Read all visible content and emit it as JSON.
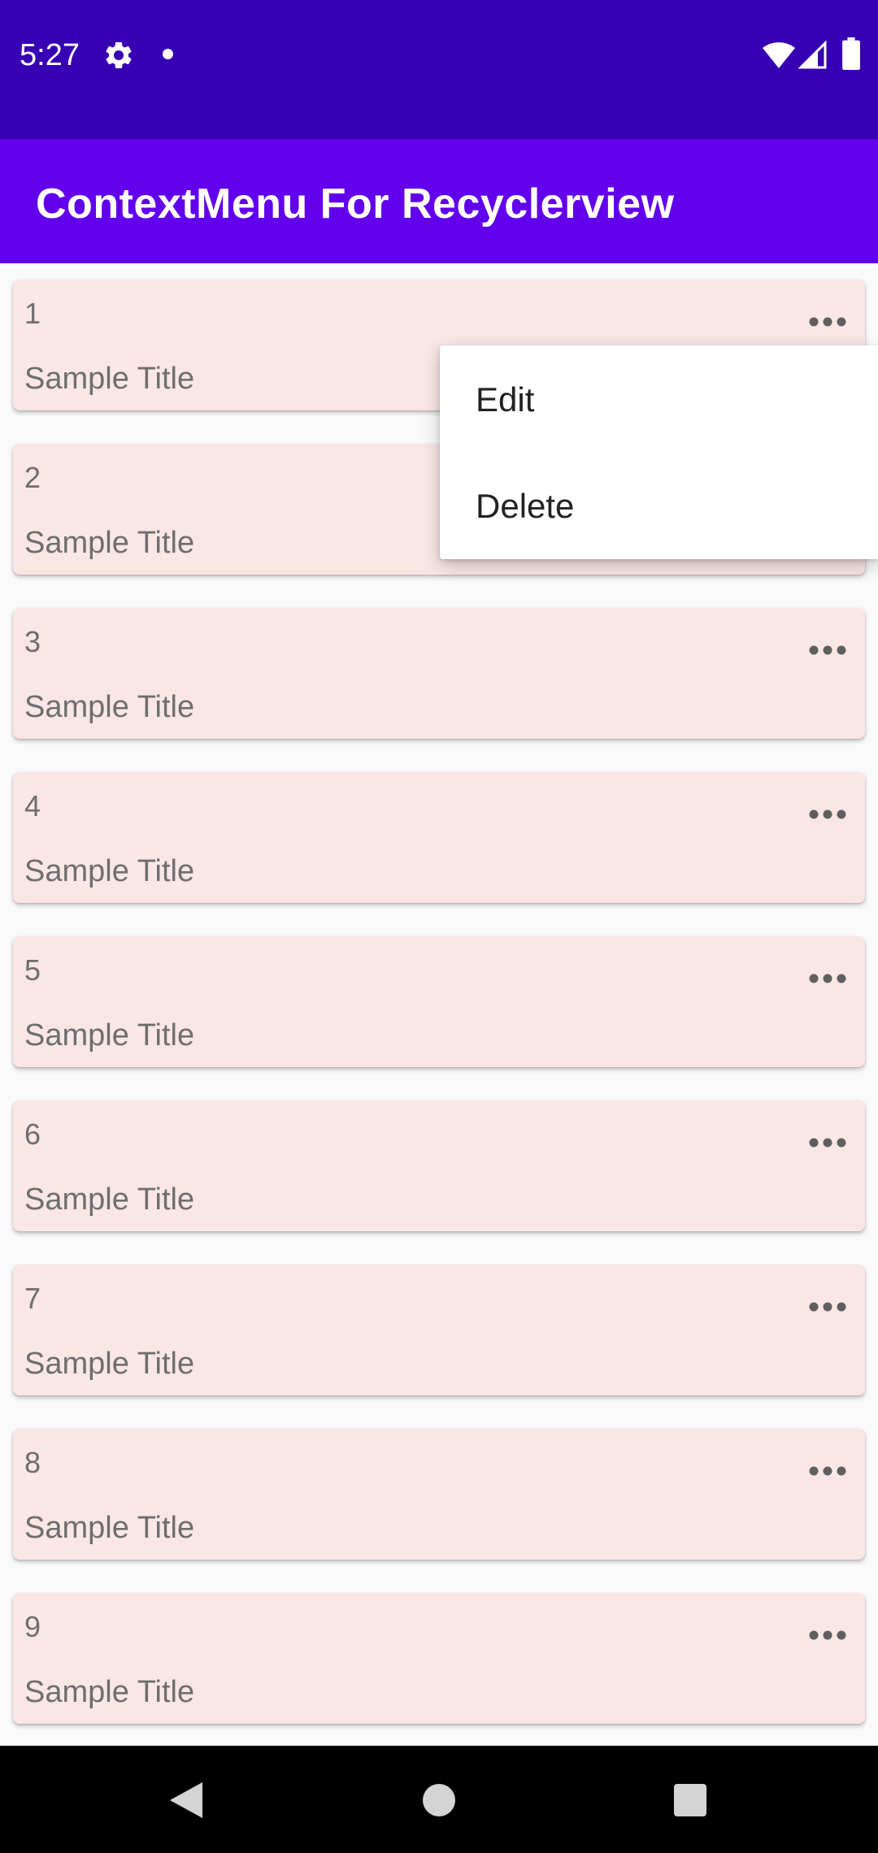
{
  "status_bar": {
    "time": "5:27",
    "icons": [
      "gear-icon",
      "dot-icon",
      "wifi-icon",
      "signal-icon",
      "battery-icon"
    ],
    "background": "#3700b3"
  },
  "app_bar": {
    "title": "ContextMenu For Recyclerview",
    "background": "#6200ee"
  },
  "list": {
    "items": [
      {
        "number": "1",
        "title": "Sample Title"
      },
      {
        "number": "2",
        "title": "Sample Title"
      },
      {
        "number": "3",
        "title": "Sample Title"
      },
      {
        "number": "4",
        "title": "Sample Title"
      },
      {
        "number": "5",
        "title": "Sample Title"
      },
      {
        "number": "6",
        "title": "Sample Title"
      },
      {
        "number": "7",
        "title": "Sample Title"
      },
      {
        "number": "8",
        "title": "Sample Title"
      },
      {
        "number": "9",
        "title": "Sample Title"
      }
    ],
    "card_color": "#fae7e5",
    "more_icon": "more-horiz-icon"
  },
  "context_menu": {
    "items": [
      {
        "label": "Edit"
      },
      {
        "label": "Delete"
      }
    ]
  },
  "nav_bar": {
    "icons": [
      "back-icon",
      "home-icon",
      "recents-icon"
    ]
  }
}
